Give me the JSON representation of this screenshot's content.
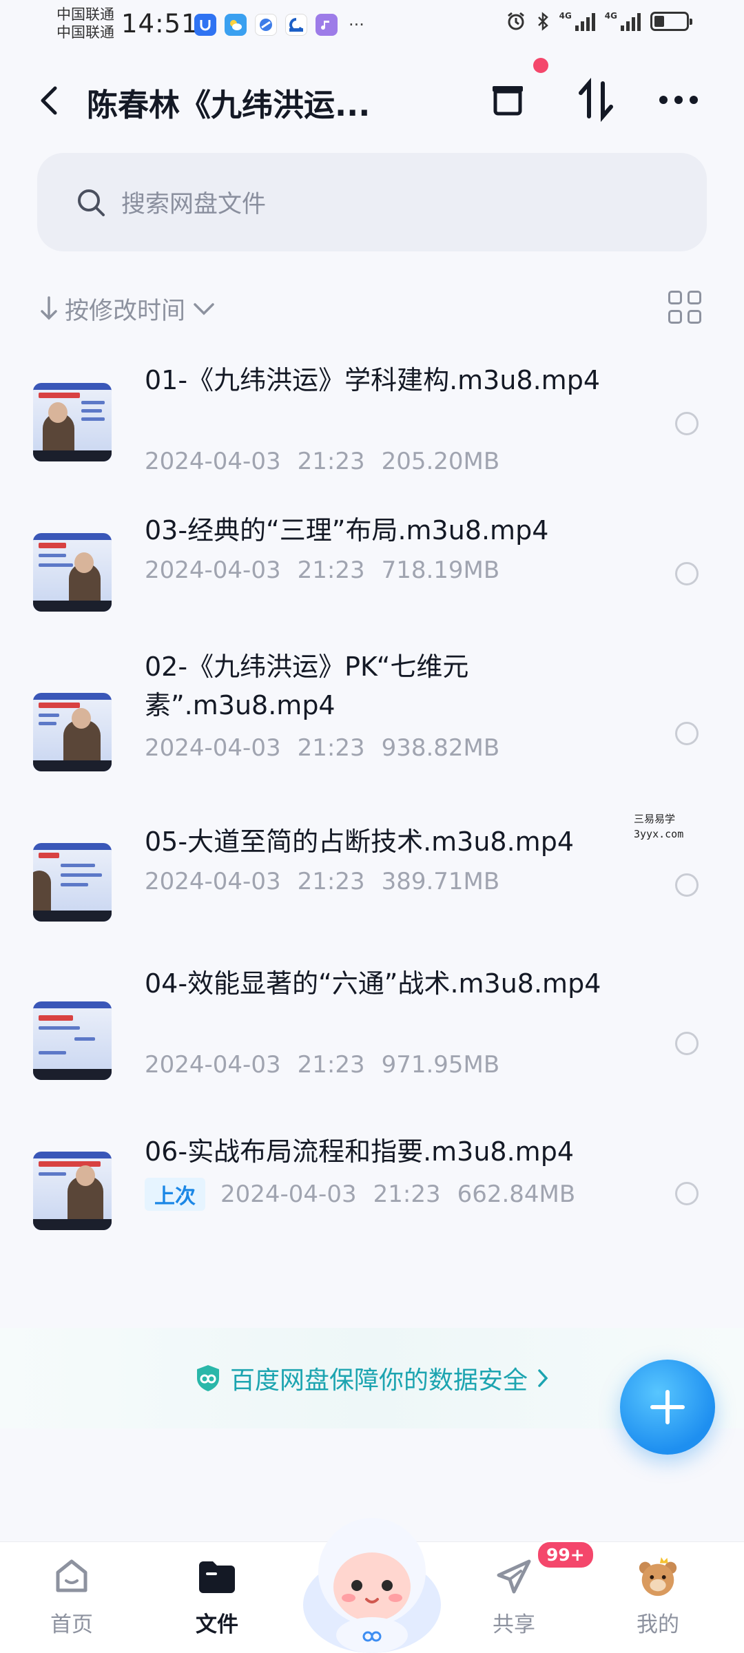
{
  "status_bar": {
    "carrier_1": "中国联通",
    "carrier_2": "中国联通",
    "time": "14:51",
    "more": "···",
    "net_1": "4G",
    "net_2": "4G"
  },
  "header": {
    "title": "陈春林《九纬洪运...",
    "has_notification_dot": true
  },
  "search": {
    "placeholder": "搜索网盘文件"
  },
  "sort": {
    "label": "按修改时间"
  },
  "files": [
    {
      "name": "01-《九纬洪运》学科建构.m3u8.mp4",
      "date": "2024-04-03",
      "time": "21:23",
      "size": "205.20MB"
    },
    {
      "name": "03-经典的“三理”布局.m3u8.mp4",
      "date": "2024-04-03",
      "time": "21:23",
      "size": "718.19MB"
    },
    {
      "name": "02-《九纬洪运》PK“七维元素”.m3u8.mp4",
      "date": "2024-04-03",
      "time": "21:23",
      "size": "938.82MB"
    },
    {
      "name": "05-大道至简的占断技术.m3u8.mp4",
      "date": "2024-04-03",
      "time": "21:23",
      "size": "389.71MB"
    },
    {
      "name": "04-效能显著的“六通”战术.m3u8.mp4",
      "date": "2024-04-03",
      "time": "21:23",
      "size": "971.95MB"
    },
    {
      "name": "06-实战布局流程和指要.m3u8.mp4",
      "badge": "上次",
      "date": "2024-04-03",
      "time": "21:23",
      "size": "662.84MB"
    }
  ],
  "watermark": {
    "line1": "三易易学",
    "line2": "3yyx.com"
  },
  "security_banner": {
    "text": "百度网盘保障你的数据安全"
  },
  "bottom_nav": {
    "items": [
      {
        "label": "首页"
      },
      {
        "label": "文件"
      },
      {
        "label": "共享"
      },
      {
        "label": "我的"
      }
    ],
    "share_badge": "99+"
  },
  "colors": {
    "accent": "#1e8ff0",
    "notification": "#f4476b",
    "security_text": "#1ca4b0"
  }
}
